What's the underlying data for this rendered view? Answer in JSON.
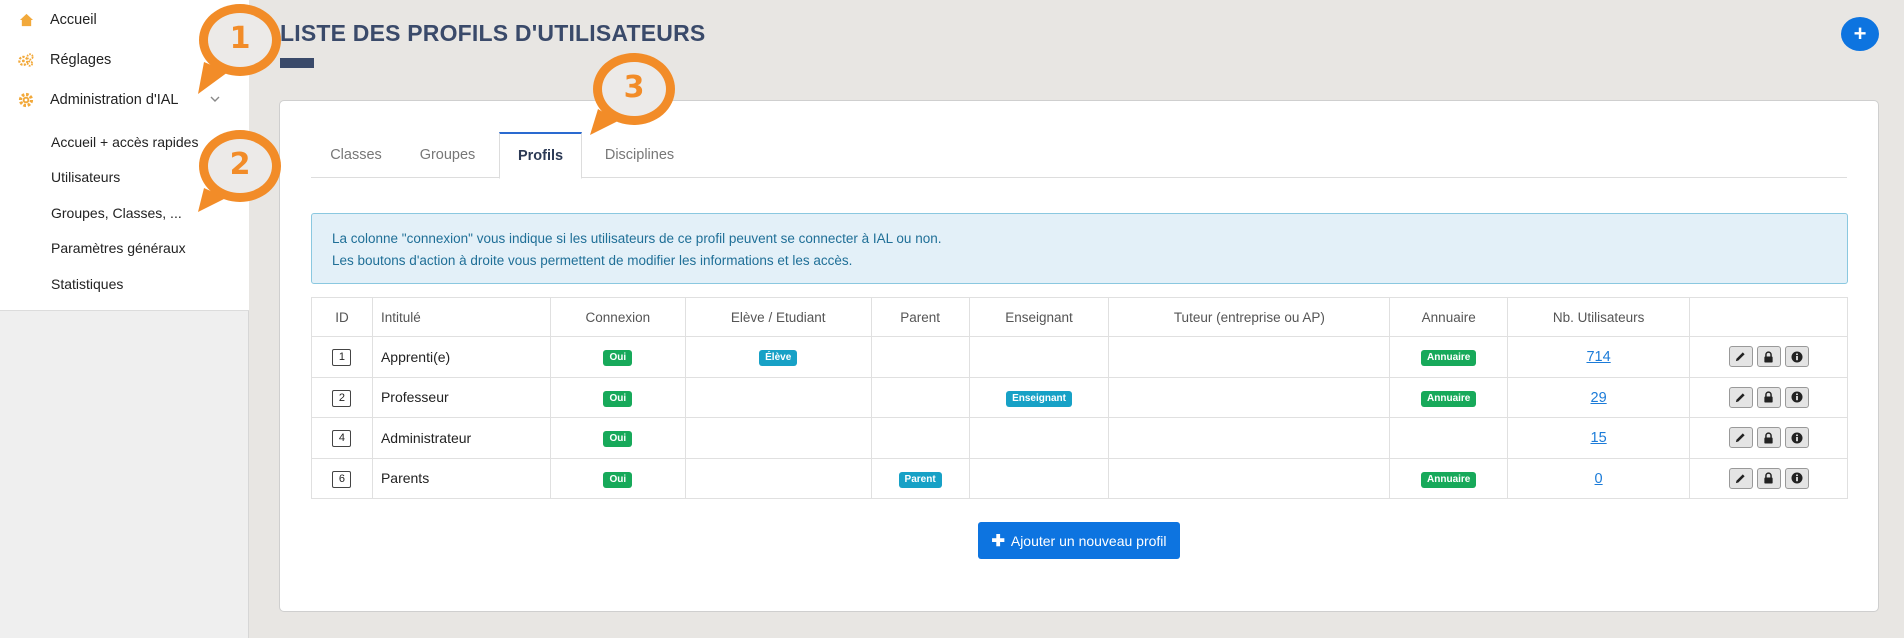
{
  "sidebar": {
    "items": [
      {
        "label": "Accueil",
        "icon": "home-icon"
      },
      {
        "label": "Réglages",
        "icon": "gears-icon"
      },
      {
        "label": "Administration d'IAL",
        "icon": "gear-icon"
      }
    ],
    "sub_items": [
      {
        "label": "Accueil + accès rapides"
      },
      {
        "label": "Utilisateurs"
      },
      {
        "label": "Groupes, Classes, ..."
      },
      {
        "label": "Paramètres généraux"
      },
      {
        "label": "Statistiques"
      }
    ]
  },
  "page": {
    "title": "LISTE DES PROFILS D'UTILISATEURS",
    "fab_label": "+"
  },
  "tabs": [
    {
      "label": "Classes"
    },
    {
      "label": "Groupes"
    },
    {
      "label": "Profils"
    },
    {
      "label": "Disciplines"
    }
  ],
  "info": {
    "line1": "La colonne \"connexion\" vous indique si les utilisateurs de ce profil peuvent se connecter à IAL ou non.",
    "line2": "Les boutons d'action à droite vous permettent de modifier les informations et les accès."
  },
  "table": {
    "headers": {
      "id": "ID",
      "intitule": "Intitulé",
      "connexion": "Connexion",
      "eleve": "Elève / Etudiant",
      "parent": "Parent",
      "enseignant": "Enseignant",
      "tuteur": "Tuteur (entreprise ou AP)",
      "annuaire": "Annuaire",
      "nb": "Nb. Utilisateurs"
    },
    "rows": [
      {
        "id": "1",
        "name": "Apprenti(e)",
        "connexion": "Oui",
        "eleve": "Élève",
        "parent": "",
        "enseignant": "",
        "tuteur": "",
        "annuaire": "Annuaire",
        "count": "714"
      },
      {
        "id": "2",
        "name": "Professeur",
        "connexion": "Oui",
        "eleve": "",
        "parent": "",
        "enseignant": "Enseignant",
        "tuteur": "",
        "annuaire": "Annuaire",
        "count": "29"
      },
      {
        "id": "4",
        "name": "Administrateur",
        "connexion": "Oui",
        "eleve": "",
        "parent": "",
        "enseignant": "",
        "tuteur": "",
        "annuaire": "",
        "count": "15"
      },
      {
        "id": "6",
        "name": "Parents",
        "connexion": "Oui",
        "eleve": "",
        "parent": "Parent",
        "enseignant": "",
        "tuteur": "",
        "annuaire": "Annuaire",
        "count": "0"
      }
    ]
  },
  "add_button": {
    "label": "Ajouter un nouveau profil"
  },
  "callouts": [
    {
      "number": "1"
    },
    {
      "number": "2"
    },
    {
      "number": "3"
    }
  ],
  "colors": {
    "accent": "#0d74e0",
    "title": "#3a4a6a",
    "success": "#17a95a",
    "info": "#17a1c6",
    "callout": "#f28c28"
  }
}
